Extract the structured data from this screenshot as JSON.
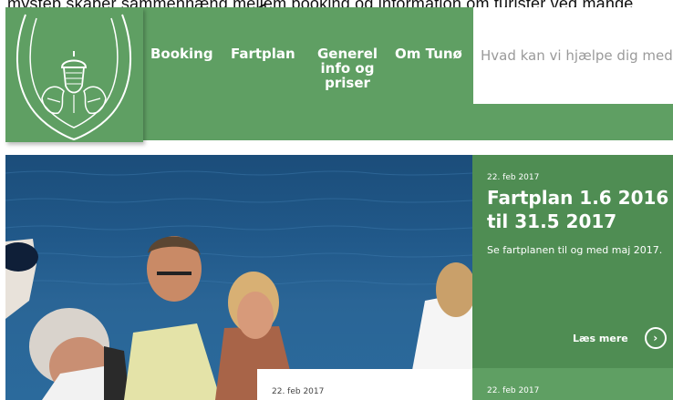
{
  "annotation": {
    "caption": "mystep skaber sammenhæng mellem booking og information om turister ved mange"
  },
  "logo": {
    "icon": "acorn-crest-icon"
  },
  "nav": {
    "items": [
      {
        "label": "Booking"
      },
      {
        "label": "Fartplan"
      },
      {
        "label": "Generel\ninfo og\npriser"
      },
      {
        "label": "Om Tunø"
      }
    ]
  },
  "search": {
    "placeholder": "Hvad kan vi hjælpe dig med?"
  },
  "hero": {
    "image": "people-on-ferry-deck-photo",
    "card_date": "22. feb 2017"
  },
  "news": [
    {
      "date": "22. feb 2017",
      "title": "Fartplan 1.6 2016 til 31.5 2017",
      "text": "Se fartplanen til og med maj 2017.",
      "read_more": "Læs mere",
      "read_more_icon": "chevron-right-circle-icon"
    },
    {
      "date": "22. feb 2017"
    }
  ],
  "colors": {
    "brand_green": "#5f9f63",
    "dark_green": "#4f8d53",
    "sea_blue": "#21598a"
  }
}
